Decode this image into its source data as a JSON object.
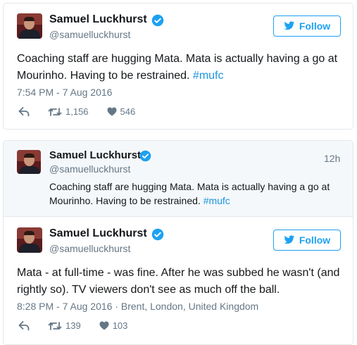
{
  "tweets": [
    {
      "name": "Samuel Luckhurst",
      "handle": "@samuelluckhurst",
      "follow_label": "Follow",
      "text_main": "Coaching staff are hugging Mata. Mata is actually having a go at Mourinho. Having to be restrained. ",
      "hashtag": "#mufc",
      "timestamp": "7:54 PM - 7 Aug 2016",
      "retweets": "1,156",
      "likes": "546"
    },
    {
      "name": "Samuel Luckhurst",
      "handle": "@samuelluckhurst",
      "follow_label": "Follow",
      "text_main": "Mata - at full-time - was fine. After he was subbed he wasn't (and rightly so). TV viewers don't see as much off the ball.",
      "timestamp": "8:28 PM - 7 Aug 2016 · Brent, London, United Kingdom",
      "retweets": "139",
      "likes": "103"
    }
  ],
  "quoted": {
    "name": "Samuel Luckhurst",
    "handle": "@samuelluckhurst",
    "time": "12h",
    "text_main": "Coaching staff are hugging Mata. Mata is actually having a go at Mourinho. Having to be restrained. ",
    "hashtag": "#mufc"
  },
  "colors": {
    "accent": "#1da1f2",
    "link": "#1b95e0",
    "muted": "#657786"
  },
  "icons": [
    "verified-badge-icon",
    "twitter-bird-icon",
    "reply-icon",
    "retweet-icon",
    "heart-icon"
  ]
}
